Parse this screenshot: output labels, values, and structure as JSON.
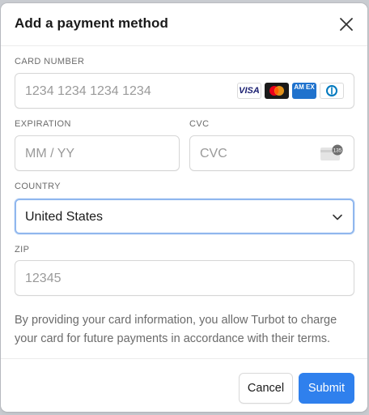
{
  "dialog": {
    "title": "Add a payment method"
  },
  "card_number": {
    "label": "CARD NUMBER",
    "placeholder": "1234 1234 1234 1234",
    "brands": [
      "visa-icon",
      "mastercard-icon",
      "amex-icon",
      "diners-club-icon"
    ],
    "visa_text": "VISA",
    "amex_text": "AM EX"
  },
  "expiration": {
    "label": "EXPIRATION",
    "placeholder": "MM / YY"
  },
  "cvc": {
    "label": "CVC",
    "placeholder": "CVC",
    "icon_badge": "135"
  },
  "country": {
    "label": "COUNTRY",
    "value": "United States"
  },
  "zip": {
    "label": "ZIP",
    "placeholder": "12345"
  },
  "notice": "By providing your card information, you allow Turbot to charge your card for future payments in accordance with their terms.",
  "footer": {
    "cancel_label": "Cancel",
    "submit_label": "Submit"
  },
  "colors": {
    "accent": "#2f80ed",
    "focus_border": "#90b7ee",
    "label": "#6b6b6b",
    "placeholder": "#9a9a9a"
  }
}
